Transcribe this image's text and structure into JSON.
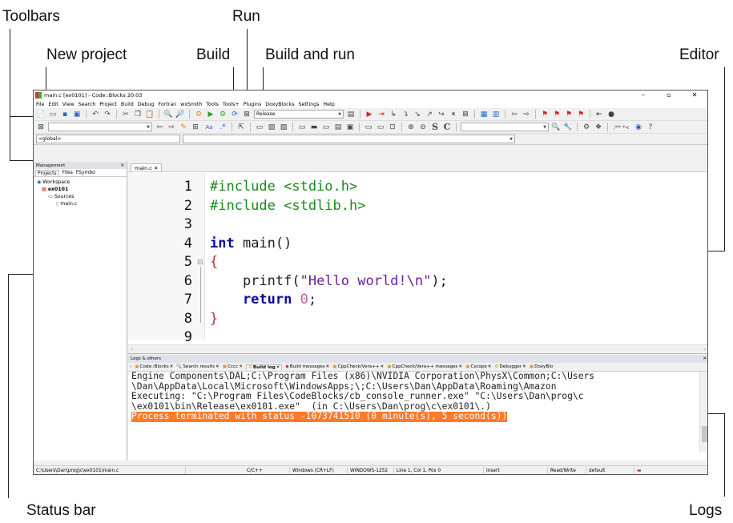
{
  "callouts": {
    "toolbars": "Toolbars",
    "run": "Run",
    "new_project": "New project",
    "build": "Build",
    "build_and_run": "Build and run",
    "editor": "Editor",
    "status_bar": "Status bar",
    "logs": "Logs"
  },
  "window": {
    "title": "main.c [ex0101] - Code::Blocks 20.03",
    "minimize": "–",
    "maximize": "▫",
    "close": "✕"
  },
  "menu": [
    "File",
    "Edit",
    "View",
    "Search",
    "Project",
    "Build",
    "Debug",
    "Fortran",
    "wxSmith",
    "Tools",
    "Tools+",
    "Plugins",
    "DoxyBlocks",
    "Settings",
    "Help"
  ],
  "toolbar": {
    "build_target": "Release",
    "comment_tokens": "/** *<",
    "text_s": "S",
    "text_c": "C",
    "aa": "Aa",
    "regex": ".*"
  },
  "scope": {
    "value": "<global>"
  },
  "management": {
    "title": "Management",
    "tabs": [
      "Projects",
      "Files",
      "FSymbo"
    ],
    "tree": {
      "workspace": "Workspace",
      "project": "ex0101",
      "sources": "Sources",
      "file": "main.c"
    }
  },
  "editor": {
    "tab": "main.c",
    "line_numbers": [
      "1",
      "2",
      "3",
      "4",
      "5",
      "6",
      "7",
      "8",
      "9"
    ],
    "code": {
      "l1": "#include <stdio.h>",
      "l2": "#include <stdlib.h>",
      "l4_kw": "int",
      "l4_rest": " main()",
      "l5": "{",
      "l6_pre": "    printf(",
      "l6_str": "\"Hello world!\\n\"",
      "l6_post": ");",
      "l7_kw": "    return",
      "l7_sp": " ",
      "l7_num": "0",
      "l7_post": ";",
      "l8": "}"
    }
  },
  "logs": {
    "title": "Logs & others",
    "tabs": [
      "Code::Blocks",
      "Search results",
      "Cccc",
      "Build log",
      "Build messages",
      "CppCheck/Vera++",
      "CppCheck/Vera++ messages",
      "Cscope",
      "Debugger",
      "DoxyBlo"
    ],
    "lines": [
      "Engine Components\\DAL;C:\\Program Files (x86)\\NVIDIA Corporation\\PhysX\\Common;C:\\Users",
      "\\Dan\\AppData\\Local\\Microsoft\\WindowsApps;\\;C:\\Users\\Dan\\AppData\\Roaming\\Amazon",
      "Executing: \"C:\\Program Files\\CodeBlocks/cb_console_runner.exe\" \"C:\\Users\\Dan\\prog\\c",
      "\\ex0101\\bin\\Release\\ex0101.exe\"  (in C:\\Users\\Dan\\prog\\c\\ex0101\\.)"
    ],
    "highlight": "Process terminated with status -1073741510 (0 minute(s), 5 second(s))"
  },
  "status": {
    "path": "C:\\Users\\Dan\\prog\\c\\ex0101\\main.c",
    "lang": "C/C++",
    "eol": "Windows (CR+LF)",
    "encoding": "WINDOWS-1252",
    "position": "Line 1, Col 1, Pos 0",
    "mode": "Insert",
    "access": "Read/Write",
    "profile": "default"
  },
  "colors": {
    "highlight_bg": "#ff7a2a",
    "preprocessor": "#1a8a1a",
    "keyword": "#0b0b9e",
    "string": "#6a1f9a"
  }
}
